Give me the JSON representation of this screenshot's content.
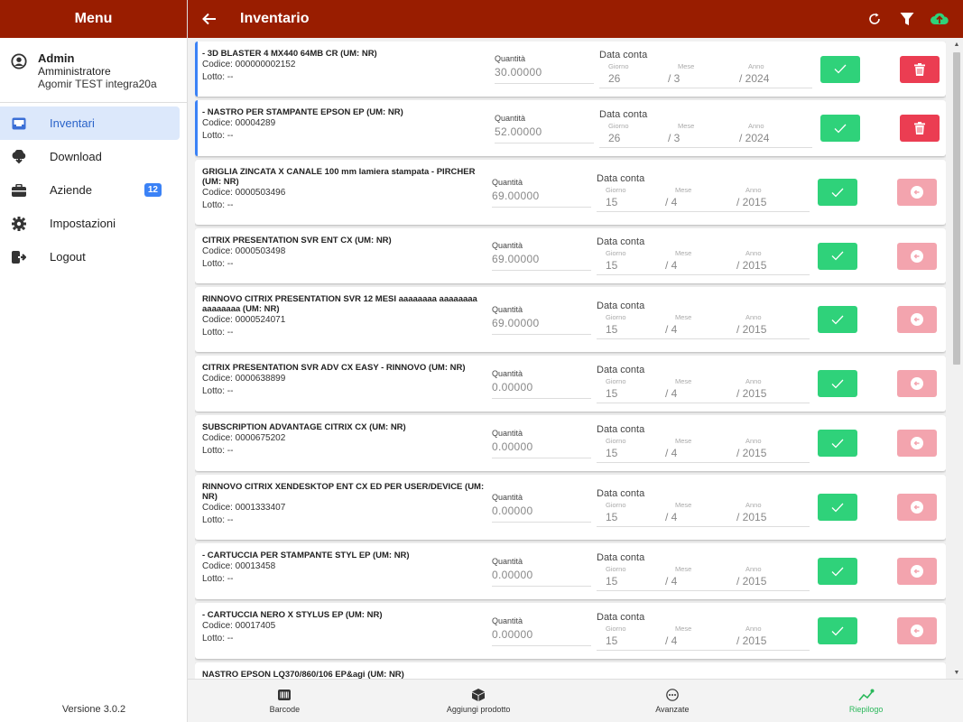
{
  "sidebar": {
    "title": "Menu",
    "user": {
      "name": "Admin",
      "role": "Amministratore",
      "company": "Agomir TEST integra20a"
    },
    "items": [
      {
        "label": "Inventari",
        "icon": "inbox-icon",
        "active": true
      },
      {
        "label": "Download",
        "icon": "cloud-download-icon"
      },
      {
        "label": "Aziende",
        "icon": "briefcase-icon",
        "badge": "12"
      },
      {
        "label": "Impostazioni",
        "icon": "gear-icon"
      },
      {
        "label": "Logout",
        "icon": "logout-icon"
      }
    ],
    "version": "Versione 3.0.2"
  },
  "topbar": {
    "title": "Inventario",
    "actions": [
      "refresh-icon",
      "filter-icon",
      "cloud-upload-icon"
    ]
  },
  "labels": {
    "qty": "Quantità",
    "date": "Data conta",
    "day": "Giorno",
    "month": "Mese",
    "year": "Anno"
  },
  "items": [
    {
      "desc": "- 3D BLASTER 4 MX440 64MB CR (UM: NR)",
      "code": "Codice: 000000002152",
      "lot": "Lotto: --",
      "qty": "30.00000",
      "day": "26",
      "month": "/ 3",
      "year": "/ 2024",
      "action": "delete"
    },
    {
      "desc": "- NASTRO PER STAMPANTE EPSON EP (UM: NR)",
      "code": "Codice: 00004289",
      "lot": "Lotto: --",
      "qty": "52.00000",
      "day": "26",
      "month": "/ 3",
      "year": "/ 2024",
      "action": "delete"
    },
    {
      "desc": "GRIGLIA ZINCATA X CANALE 100 mm lamiera stampata - PIRCHER (UM: NR)",
      "code": "Codice: 0000503496",
      "lot": "Lotto: --",
      "qty": "69.00000",
      "day": "15",
      "month": "/ 4",
      "year": "/ 2015",
      "action": "restore"
    },
    {
      "desc": "CITRIX PRESENTATION SVR ENT CX (UM: NR)",
      "code": "Codice: 0000503498",
      "lot": "Lotto: --",
      "qty": "69.00000",
      "day": "15",
      "month": "/ 4",
      "year": "/ 2015",
      "action": "restore"
    },
    {
      "desc": "RINNOVO CITRIX PRESENTATION SVR 12 MESI aaaaaaaa aaaaaaaa aaaaaaaa (UM: NR)",
      "code": "Codice: 0000524071",
      "lot": "Lotto: --",
      "qty": "69.00000",
      "day": "15",
      "month": "/ 4",
      "year": "/ 2015",
      "action": "restore"
    },
    {
      "desc": "CITRIX PRESENTATION SVR ADV CX EASY - RINNOVO (UM: NR)",
      "code": "Codice: 0000638899",
      "lot": "Lotto: --",
      "qty": "0.00000",
      "day": "15",
      "month": "/ 4",
      "year": "/ 2015",
      "action": "restore"
    },
    {
      "desc": "SUBSCRIPTION ADVANTAGE CITRIX CX (UM: NR)",
      "code": "Codice: 0000675202",
      "lot": "Lotto: --",
      "qty": "0.00000",
      "day": "15",
      "month": "/ 4",
      "year": "/ 2015",
      "action": "restore"
    },
    {
      "desc": "RINNOVO CITRIX XENDESKTOP ENT CX ED PER USER/DEVICE (UM: NR)",
      "code": "Codice: 0001333407",
      "lot": "Lotto: --",
      "qty": "0.00000",
      "day": "15",
      "month": "/ 4",
      "year": "/ 2015",
      "action": "restore"
    },
    {
      "desc": "- CARTUCCIA PER STAMPANTE STYL EP (UM: NR)",
      "code": "Codice: 00013458",
      "lot": "Lotto: --",
      "qty": "0.00000",
      "day": "15",
      "month": "/ 4",
      "year": "/ 2015",
      "action": "restore"
    },
    {
      "desc": "- CARTUCCIA NERO X STYLUS EP (UM: NR)",
      "code": "Codice: 00017405",
      "lot": "Lotto: --",
      "qty": "0.00000",
      "day": "15",
      "month": "/ 4",
      "year": "/ 2015",
      "action": "restore"
    },
    {
      "desc": "NASTRO EPSON LQ370/860/106 EP&agi (UM: NR)",
      "code": "",
      "lot": "",
      "qty": "",
      "day": "",
      "month": "",
      "year": "",
      "action": "none"
    }
  ],
  "bottom_tabs": [
    {
      "label": "Barcode",
      "icon": "barcode-icon"
    },
    {
      "label": "Aggiungi prodotto",
      "icon": "box-icon"
    },
    {
      "label": "Avanzate",
      "icon": "more-icon"
    },
    {
      "label": "Riepilogo",
      "icon": "chart-line-icon",
      "active": true
    }
  ]
}
